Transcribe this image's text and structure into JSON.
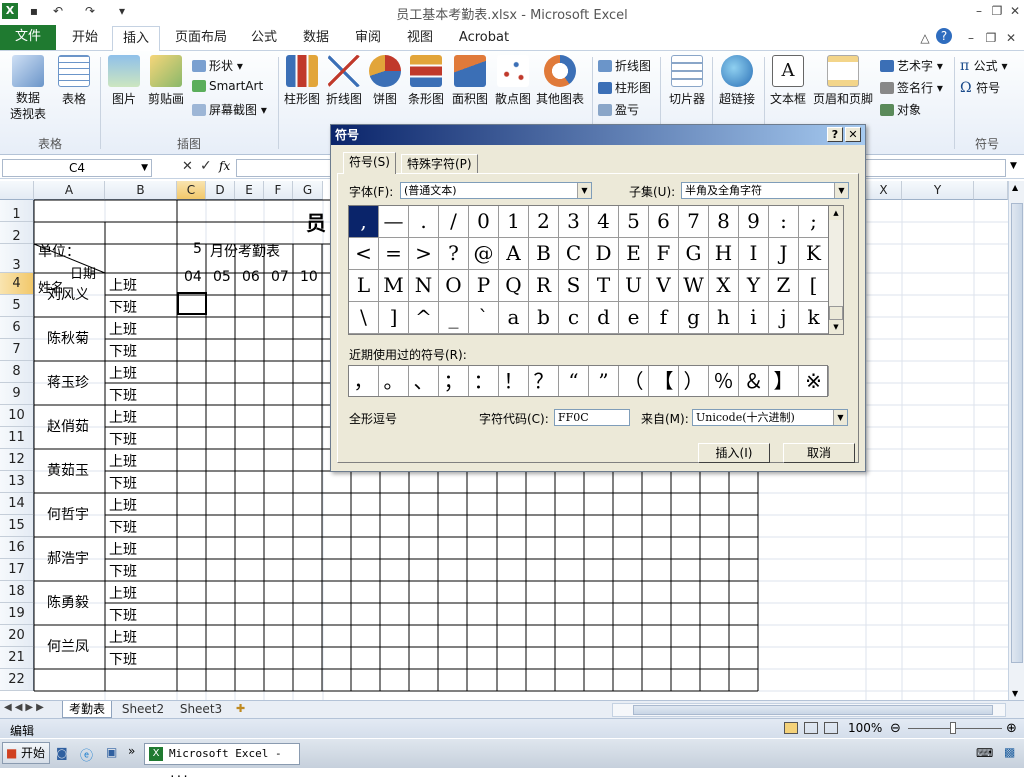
{
  "window": {
    "title": "员工基本考勤表.xlsx - Microsoft Excel"
  },
  "tabs": [
    "文件",
    "开始",
    "插入",
    "页面布局",
    "公式",
    "数据",
    "审阅",
    "视图",
    "Acrobat"
  ],
  "ribbon": {
    "buttons": [
      {
        "label": "数据\n透视表",
        "id": "pivot"
      },
      {
        "label": "表格",
        "id": "table"
      },
      {
        "label": "图片",
        "id": "picture"
      },
      {
        "label": "剪贴画",
        "id": "clipart"
      },
      {
        "label": "柱形图",
        "id": "col-chart"
      },
      {
        "label": "折线图",
        "id": "line-chart"
      },
      {
        "label": "饼图",
        "id": "pie-chart"
      },
      {
        "label": "条形图",
        "id": "bar-chart"
      },
      {
        "label": "面积图",
        "id": "area-chart"
      },
      {
        "label": "散点图",
        "id": "scatter-chart"
      },
      {
        "label": "其他图表",
        "id": "other-chart"
      },
      {
        "label": "切片器",
        "id": "slicer"
      },
      {
        "label": "超链接",
        "id": "hyperlink"
      },
      {
        "label": "文本框",
        "id": "textbox"
      },
      {
        "label": "页眉和页脚",
        "id": "headerfooter"
      }
    ],
    "small": {
      "shape": "形状",
      "smartart": "SmartArt",
      "screenshot": "屏幕截图",
      "spark_line": "折线图",
      "spark_col": "柱形图",
      "spark_wl": "盈亏",
      "wordart": "艺术字",
      "sigline": "签名行",
      "object": "对象",
      "equation": "公式",
      "symbol": "符号"
    },
    "groups": {
      "tables": "表格",
      "illustrations": "插图",
      "symbols": "符号"
    }
  },
  "formula": {
    "namebox": "C4",
    "fx": "fx"
  },
  "sheet": {
    "columns": [
      "A",
      "B",
      "C",
      "D",
      "E",
      "F",
      "G",
      "X",
      "Y"
    ],
    "rows": [
      "1",
      "2",
      "3",
      "4",
      "5",
      "6",
      "7",
      "8",
      "9",
      "10",
      "11",
      "12",
      "13",
      "14",
      "15",
      "16",
      "17",
      "18",
      "19",
      "20",
      "21",
      "22"
    ],
    "title_char": "员",
    "unit_label": "单位：",
    "month": "5",
    "month_label": "月份考勤表",
    "corner_date": "日期",
    "corner_name": "姓名",
    "days": [
      "04",
      "05",
      "06",
      "07",
      "10"
    ],
    "employees": [
      "刘风义",
      "陈秋菊",
      "蒋玉珍",
      "赵俏茹",
      "黄茹玉",
      "何哲宇",
      "郝浩宇",
      "陈勇毅",
      "何兰凤"
    ],
    "shift_on": "上班",
    "shift_off": "下班"
  },
  "sheet_tabs": [
    "考勤表",
    "Sheet2",
    "Sheet3"
  ],
  "status": {
    "mode": "编辑",
    "zoom": "100%"
  },
  "taskbar": {
    "start": "开始",
    "app": "Microsoft Excel - ..."
  },
  "dialog": {
    "title": "符号",
    "tab_symbols": "符号(S)",
    "tab_special": "特殊字符(P)",
    "font_label": "字体(F):",
    "font_value": "(普通文本)",
    "subset_label": "子集(U):",
    "subset_value": "半角及全角字符",
    "symbols": [
      ",",
      "—",
      ".",
      "/",
      "0",
      "1",
      "2",
      "3",
      "4",
      "5",
      "6",
      "7",
      "8",
      "9",
      ":",
      ";",
      "<",
      "=",
      ">",
      "?",
      "@",
      "A",
      "B",
      "C",
      "D",
      "E",
      "F",
      "G",
      "H",
      "I",
      "J",
      "K",
      "L",
      "M",
      "N",
      "O",
      "P",
      "Q",
      "R",
      "S",
      "T",
      "U",
      "V",
      "W",
      "X",
      "Y",
      "Z",
      "[",
      "\\",
      "]",
      "^",
      "_",
      "`",
      "a",
      "b",
      "c",
      "d",
      "e",
      "f",
      "g",
      "h",
      "i",
      "j",
      "k"
    ],
    "recent_label": "近期使用过的符号(R):",
    "recent": [
      "，",
      "。",
      "、",
      "；",
      "：",
      "！",
      "？",
      "“",
      "”",
      "（",
      "【",
      "）",
      "％",
      "＆",
      "】",
      "※"
    ],
    "char_name": "全形逗号",
    "code_label": "字符代码(C):",
    "code_value": "FF0C",
    "from_label": "来自(M):",
    "from_value": "Unicode(十六进制)",
    "insert": "插入(I)",
    "cancel": "取消"
  }
}
